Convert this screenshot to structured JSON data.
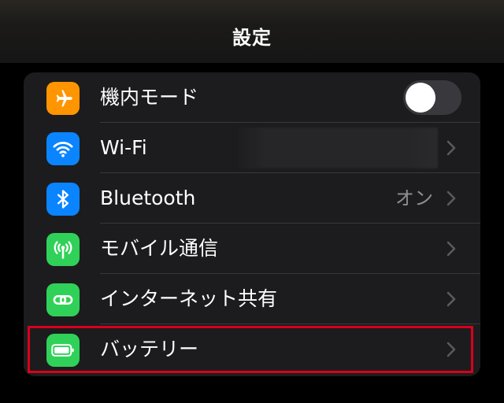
{
  "nav": {
    "title": "設定"
  },
  "settings": {
    "rows": [
      {
        "id": "airplane",
        "label": "機内モード",
        "icon": "airplane-icon",
        "icon_color": "#ff9500",
        "control": "toggle",
        "toggle_on": false
      },
      {
        "id": "wifi",
        "label": "Wi-Fi",
        "icon": "wifi-icon",
        "icon_color": "#0a84ff",
        "control": "chevron"
      },
      {
        "id": "bluetooth",
        "label": "Bluetooth",
        "value": "オン",
        "icon": "bluetooth-icon",
        "icon_color": "#0a84ff",
        "control": "chevron"
      },
      {
        "id": "cellular",
        "label": "モバイル通信",
        "icon": "antenna-icon",
        "icon_color": "#30d158",
        "control": "chevron"
      },
      {
        "id": "hotspot",
        "label": "インターネット共有",
        "icon": "link-icon",
        "icon_color": "#30d158",
        "control": "chevron"
      },
      {
        "id": "battery",
        "label": "バッテリー",
        "icon": "battery-icon",
        "icon_color": "#30d158",
        "control": "chevron",
        "highlighted": true
      }
    ]
  },
  "colors": {
    "highlight": "#d9001b",
    "background": "#000000",
    "group_background": "#1c1c1e",
    "secondary_text": "#8e8e93"
  }
}
